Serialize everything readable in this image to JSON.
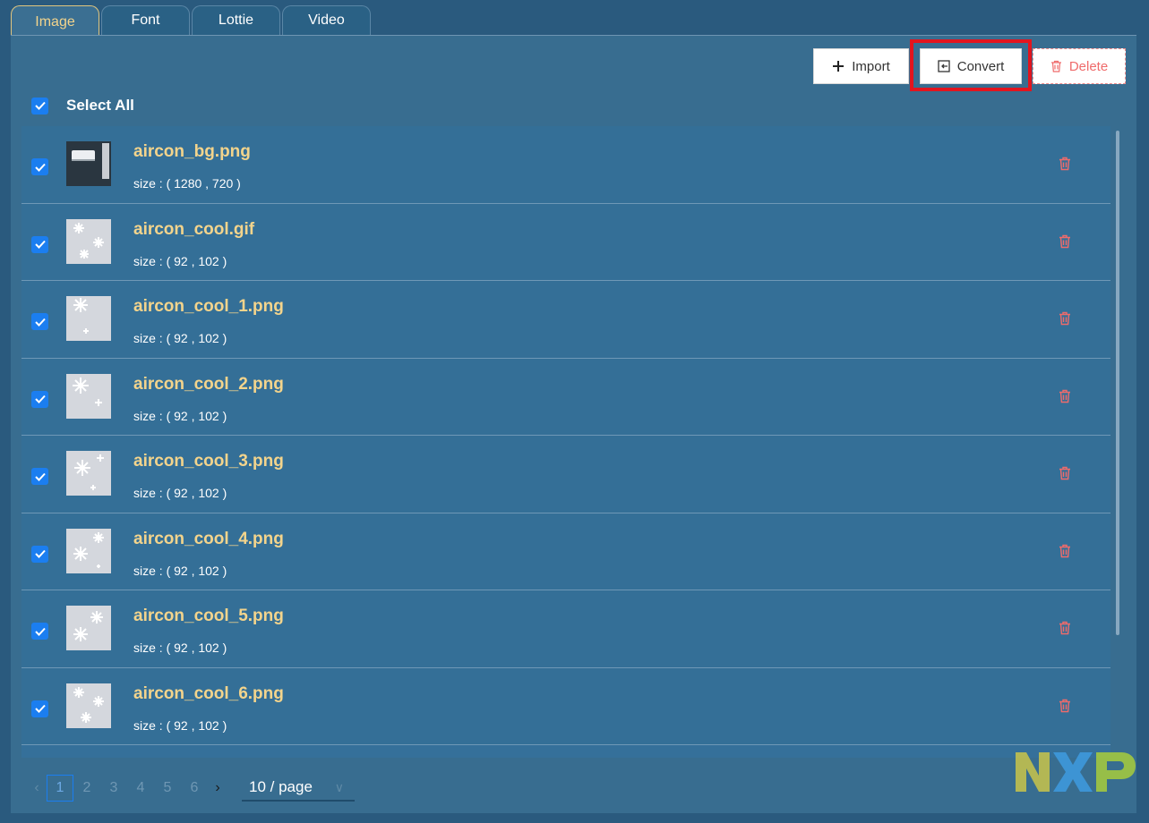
{
  "tabs": [
    {
      "label": "Image"
    },
    {
      "label": "Font"
    },
    {
      "label": "Lottie"
    },
    {
      "label": "Video"
    }
  ],
  "toolbar": {
    "import_label": "Import",
    "convert_label": "Convert",
    "delete_label": "Delete"
  },
  "select_all_label": "Select All",
  "items": [
    {
      "name": "aircon_bg.png",
      "size": "size : ( 1280 , 720 )",
      "thumb_icon": "aircon-photo-thumbnail",
      "checked": true
    },
    {
      "name": "aircon_cool.gif",
      "size": "size : ( 92 , 102 )",
      "thumb_icon": "snowflake-thumbnail",
      "checked": true
    },
    {
      "name": "aircon_cool_1.png",
      "size": "size : ( 92 , 102 )",
      "thumb_icon": "snowflake-thumbnail",
      "checked": true
    },
    {
      "name": "aircon_cool_2.png",
      "size": "size : ( 92 , 102 )",
      "thumb_icon": "snowflake-thumbnail",
      "checked": true
    },
    {
      "name": "aircon_cool_3.png",
      "size": "size : ( 92 , 102 )",
      "thumb_icon": "snowflake-thumbnail",
      "checked": true
    },
    {
      "name": "aircon_cool_4.png",
      "size": "size : ( 92 , 102 )",
      "thumb_icon": "snowflake-thumbnail",
      "checked": true
    },
    {
      "name": "aircon_cool_5.png",
      "size": "size : ( 92 , 102 )",
      "thumb_icon": "snowflake-thumbnail",
      "checked": true
    },
    {
      "name": "aircon_cool_6.png",
      "size": "size : ( 92 , 102 )",
      "thumb_icon": "snowflake-thumbnail",
      "checked": true
    }
  ],
  "pagination": {
    "pages": [
      "1",
      "2",
      "3",
      "4",
      "5",
      "6"
    ],
    "current": "1",
    "page_size": "10 / page"
  },
  "colors": {
    "background": "#2a5a7e",
    "filename": "#f3d48c",
    "checkbox": "#1b7ef0",
    "delete": "#ef6b6b",
    "highlight_frame": "#e2151e"
  },
  "logo": "NXP"
}
